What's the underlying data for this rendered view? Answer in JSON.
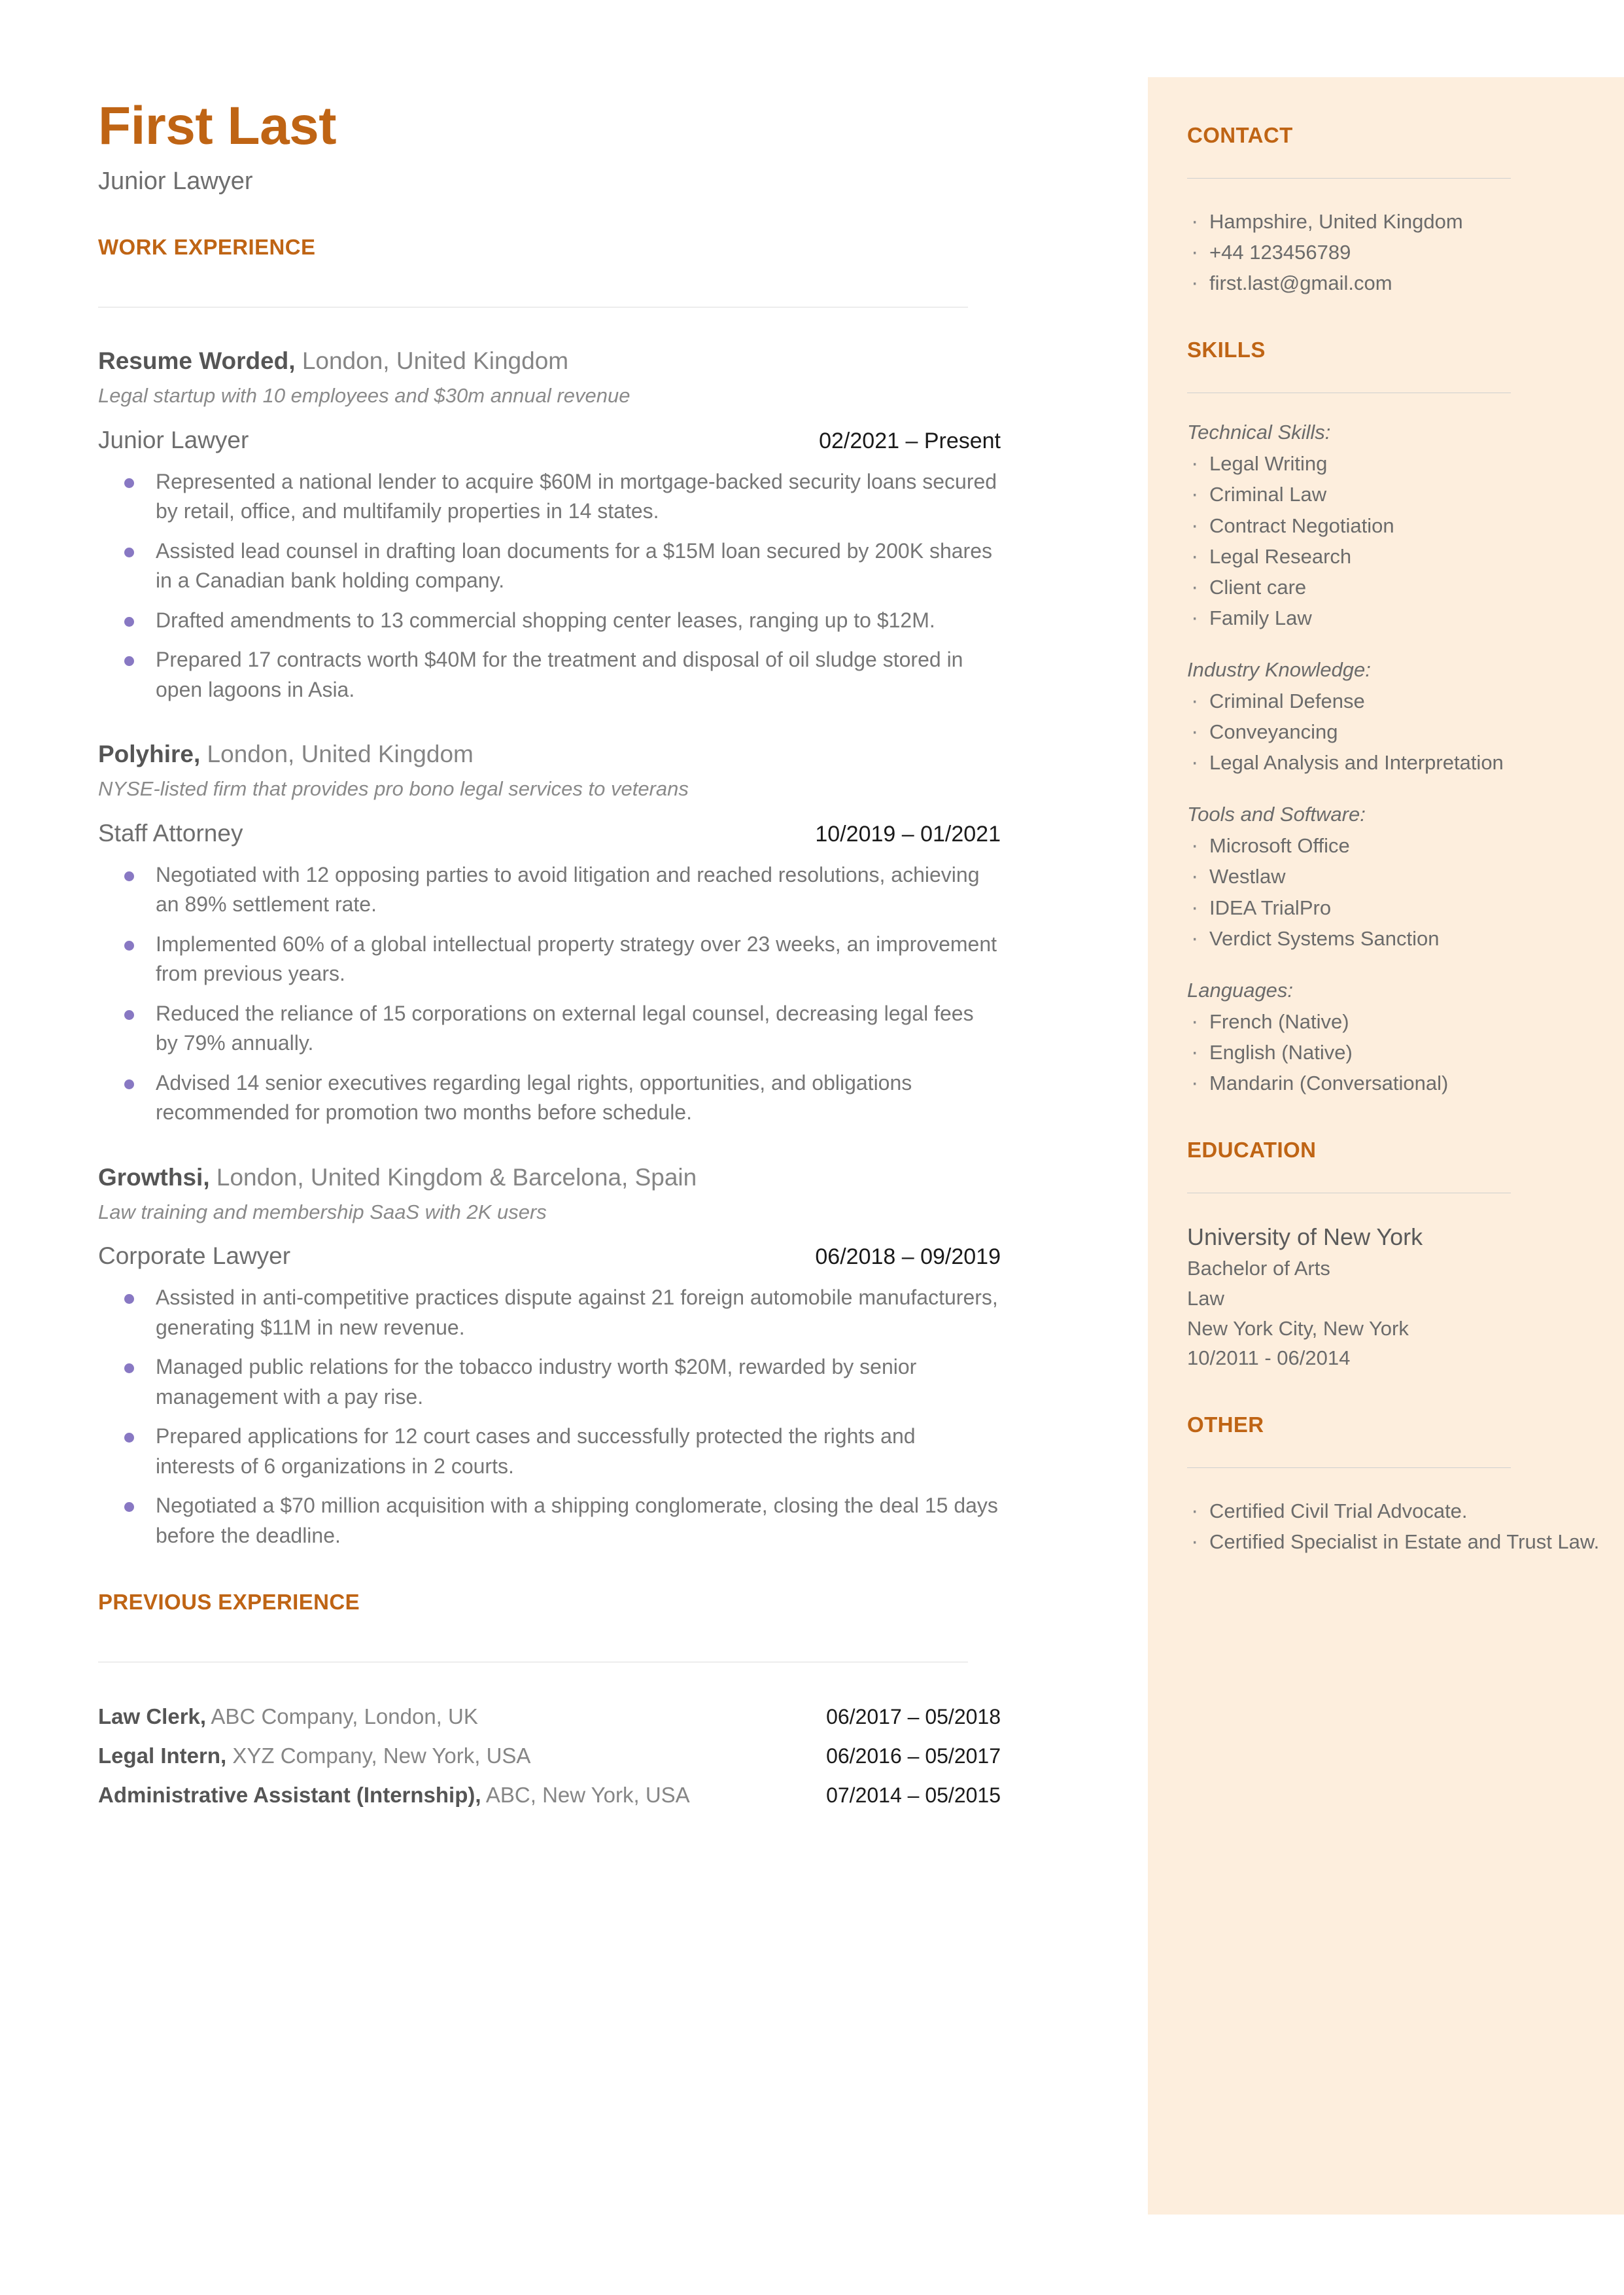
{
  "theme": {
    "accent": "#bf6414",
    "sidebar_bg": "#fdeedd",
    "bullet": "#8878c3",
    "body_text": "#767676"
  },
  "header": {
    "name": "First Last",
    "role": "Junior Lawyer"
  },
  "sections": {
    "work_experience": "WORK EXPERIENCE",
    "previous_experience": "PREVIOUS EXPERIENCE",
    "contact": "CONTACT",
    "skills": "SKILLS",
    "education": "EDUCATION",
    "other": "OTHER"
  },
  "jobs": [
    {
      "company": "Resume Worded,",
      "location": " London, United Kingdom",
      "description": "Legal startup with 10 employees and $30m annual revenue",
      "title": "Junior Lawyer",
      "dates": "02/2021 – Present",
      "bullets": [
        "Represented a national lender to acquire $60M in mortgage-backed security loans secured by retail, office, and multifamily properties in 14 states.",
        "Assisted lead counsel in drafting loan documents for a $15M  loan secured by 200K shares in a Canadian bank holding company.",
        "Drafted amendments to 13 commercial shopping center leases, ranging up to $12M.",
        "Prepared 17 contracts worth $40M for the treatment and disposal of oil sludge stored in open lagoons in Asia."
      ]
    },
    {
      "company": "Polyhire,",
      "location": " London, United Kingdom",
      "description": "NYSE-listed firm that provides pro bono legal services to veterans",
      "title": "Staff Attorney",
      "dates": "10/2019 – 01/2021",
      "bullets": [
        "Negotiated with 12 opposing parties to avoid litigation and reached resolutions, achieving an 89% settlement rate.",
        "Implemented 60% of a global intellectual property strategy over 23 weeks, an improvement from previous years.",
        "Reduced the reliance of 15 corporations on external legal counsel, decreasing legal fees by 79% annually.",
        "Advised 14 senior executives regarding legal rights, opportunities, and obligations recommended for promotion two months before schedule."
      ]
    },
    {
      "company": "Growthsi,",
      "location": " London, United Kingdom & Barcelona, Spain",
      "description": "Law training and membership SaaS with 2K users",
      "title": "Corporate Lawyer",
      "dates": "06/2018 – 09/2019",
      "bullets": [
        "Assisted in anti-competitive practices dispute against 21 foreign automobile manufacturers, generating $11M in new revenue.",
        "Managed public relations for the tobacco industry worth $20M, rewarded by senior management with a pay rise.",
        "Prepared applications for 12 court cases and successfully protected the rights and interests of 6 organizations in 2 courts.",
        "Negotiated a $70 million acquisition with a shipping conglomerate, closing the deal 15 days before the deadline."
      ]
    }
  ],
  "previous_experience": [
    {
      "title": "Law Clerk,",
      "detail": " ABC Company, London, UK",
      "dates": "06/2017 – 05/2018"
    },
    {
      "title": "Legal Intern,",
      "detail": " XYZ Company, New York, USA",
      "dates": "06/2016 – 05/2017"
    },
    {
      "title": "Administrative Assistant (Internship),",
      "detail": " ABC, New York, USA",
      "dates": "07/2014 – 05/2015"
    }
  ],
  "contact": [
    "Hampshire, United Kingdom",
    "+44 123456789",
    "first.last@gmail.com"
  ],
  "skills": [
    {
      "group": "Technical Skills:",
      "items": [
        "Legal Writing",
        "Criminal Law",
        "Contract Negotiation",
        "Legal Research",
        "Client care",
        "Family Law"
      ]
    },
    {
      "group": "Industry Knowledge:",
      "items": [
        "Criminal Defense",
        "Conveyancing",
        "Legal Analysis and Interpretation"
      ]
    },
    {
      "group": "Tools and Software:",
      "items": [
        "Microsoft Office",
        "Westlaw",
        "IDEA TrialPro",
        "Verdict Systems Sanction"
      ]
    },
    {
      "group": "Languages:",
      "items": [
        "French (Native)",
        "English (Native)",
        "Mandarin (Conversational)"
      ]
    }
  ],
  "education": {
    "school": "University of New York",
    "degree": "Bachelor of Arts",
    "field": "Law",
    "place": "New York City, New York",
    "dates": "10/2011 - 06/2014"
  },
  "other": [
    "Certified Civil Trial Advocate.",
    "Certified Specialist in Estate and Trust Law."
  ]
}
